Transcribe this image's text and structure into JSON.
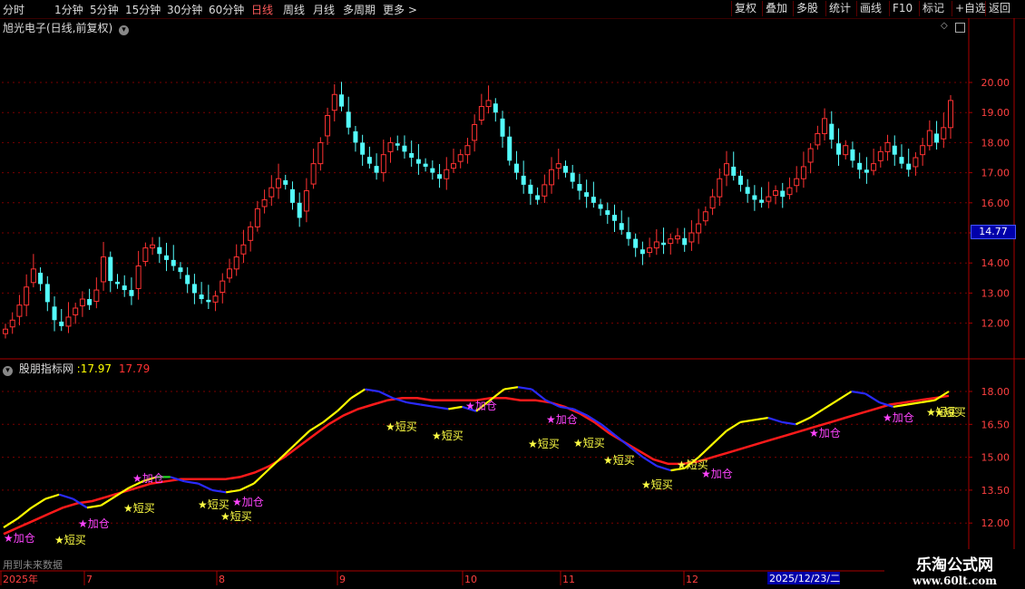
{
  "toolbar": {
    "periods": [
      "分时",
      "1分钟",
      "5分钟",
      "15分钟",
      "30分钟",
      "60分钟",
      "日线",
      "周线",
      "月线",
      "多周期",
      "更多 >"
    ],
    "active_period": "日线",
    "right_buttons": [
      "复权",
      "叠加",
      "多股",
      "统计",
      "画线",
      "F10",
      "标记",
      "+自选",
      "返回"
    ]
  },
  "main_panel": {
    "title": "旭光电子(日线,前复权)",
    "y_ticks": [
      "20.00",
      "19.00",
      "18.00",
      "17.00",
      "16.00",
      "15.00",
      "14.00",
      "13.00",
      "12.00"
    ],
    "price_badge": "14.77"
  },
  "indicator_panel": {
    "name": "股朋指标网",
    "value1": ":17.97",
    "value2": "17.79",
    "y_ticks": [
      "18.00",
      "16.50",
      "15.00",
      "13.50",
      "12.00"
    ]
  },
  "x_axis": {
    "labels": [
      "2025年",
      "7",
      "8",
      "9",
      "10",
      "11",
      "12"
    ],
    "highlight": "2025/12/23/二"
  },
  "signals": [
    {
      "text": "★加仓",
      "type": "add"
    },
    {
      "text": "★短买",
      "type": "buy"
    },
    {
      "text": "★加仓",
      "type": "add"
    },
    {
      "text": "★短买",
      "type": "buy"
    },
    {
      "text": "★加仓",
      "type": "add"
    },
    {
      "text": "★短买",
      "type": "buy"
    },
    {
      "text": "★短买",
      "type": "buy"
    },
    {
      "text": "★加仓",
      "type": "add"
    },
    {
      "text": "★短买",
      "type": "buy"
    },
    {
      "text": "★短买",
      "type": "buy"
    },
    {
      "text": "★加仓",
      "type": "add"
    },
    {
      "text": "★短买",
      "type": "buy"
    },
    {
      "text": "★加仓",
      "type": "add"
    },
    {
      "text": "★短买",
      "type": "buy"
    },
    {
      "text": "★短买",
      "type": "buy"
    },
    {
      "text": "★短买",
      "type": "buy"
    },
    {
      "text": "★短买",
      "type": "buy"
    },
    {
      "text": "★加仓",
      "type": "add"
    },
    {
      "text": "★加仓",
      "type": "add"
    },
    {
      "text": "★加仓",
      "type": "add"
    },
    {
      "text": "★短买",
      "type": "buy"
    },
    {
      "text": "★短买",
      "type": "buy"
    }
  ],
  "status_text": "用到未来数据",
  "watermark": {
    "line1": "乐淘公式网",
    "line2": "www.60lt.com"
  },
  "colors": {
    "up": "#ff3232",
    "down": "#54ffff",
    "line_yellow": "#ffff00",
    "line_blue": "#2a2aff",
    "line_green": "#22dd22",
    "line_red": "#ff1a1a",
    "add": "#ff44ff",
    "buy": "#ffff44"
  },
  "chart_data": [
    {
      "type": "candlestick",
      "title": "旭光电子(日线,前复权)",
      "ylim": [
        11.3,
        21.5
      ],
      "closes": [
        11.8,
        12.1,
        12.6,
        13.2,
        13.8,
        13.3,
        12.7,
        12.1,
        11.9,
        12.2,
        12.5,
        12.8,
        12.6,
        13.1,
        14.2,
        13.4,
        13.3,
        13.1,
        12.9,
        13.9,
        14.5,
        14.6,
        14.3,
        14.1,
        13.9,
        13.7,
        13.3,
        13.0,
        12.8,
        12.7,
        12.9,
        13.4,
        13.8,
        14.2,
        14.6,
        15.2,
        15.8,
        16.1,
        16.5,
        16.8,
        16.6,
        16.0,
        15.5,
        16.4,
        17.3,
        18.0,
        18.9,
        19.6,
        19.2,
        18.5,
        18.0,
        17.6,
        17.3,
        17.0,
        17.6,
        18.0,
        17.9,
        17.7,
        17.5,
        17.3,
        17.2,
        17.0,
        16.8,
        17.1,
        17.3,
        17.6,
        17.9,
        18.6,
        19.2,
        19.4,
        19.0,
        18.2,
        17.4,
        17.0,
        16.6,
        16.3,
        16.1,
        16.6,
        17.1,
        17.3,
        17.0,
        16.7,
        16.4,
        16.2,
        16.0,
        15.8,
        15.6,
        15.4,
        15.1,
        14.8,
        14.5,
        14.3,
        14.5,
        14.7,
        14.6,
        14.8,
        14.9,
        14.6,
        15.0,
        15.3,
        15.7,
        16.2,
        16.8,
        17.3,
        16.9,
        16.6,
        16.3,
        16.1,
        16.0,
        16.2,
        16.4,
        16.2,
        16.5,
        16.8,
        17.2,
        17.8,
        18.3,
        18.8,
        18.1,
        17.6,
        17.9,
        17.4,
        17.1,
        17.0,
        17.3,
        17.7,
        18.0,
        17.6,
        17.3,
        17.1,
        17.5,
        17.9,
        18.4,
        18.0,
        18.5,
        19.4
      ],
      "x_labels": [
        "2025年",
        "7",
        "8",
        "9",
        "10",
        "11",
        "12"
      ]
    },
    {
      "type": "line",
      "title": "股朋指标网",
      "ylim": [
        11.4,
        18.8
      ],
      "series": [
        {
          "name": "17.97",
          "values": [
            11.8,
            12.2,
            12.7,
            13.1,
            13.3,
            13.1,
            12.7,
            12.8,
            13.2,
            13.6,
            13.9,
            14.1,
            14.1,
            13.9,
            13.8,
            13.5,
            13.4,
            13.5,
            13.8,
            14.4,
            15.0,
            15.6,
            16.2,
            16.6,
            17.1,
            17.7,
            18.1,
            18.0,
            17.7,
            17.5,
            17.4,
            17.3,
            17.2,
            17.3,
            17.1,
            17.6,
            18.1,
            18.2,
            18.1,
            17.6,
            17.3,
            17.2,
            16.9,
            16.5,
            16.0,
            15.5,
            15.0,
            14.6,
            14.4,
            14.5,
            15.0,
            15.6,
            16.2,
            16.6,
            16.7,
            16.8,
            16.6,
            16.5,
            16.8,
            17.2,
            17.6,
            18.0,
            17.9,
            17.5,
            17.3,
            17.4,
            17.5,
            17.6,
            18.0
          ]
        },
        {
          "name": "17.79",
          "values": [
            11.5,
            11.8,
            12.1,
            12.4,
            12.7,
            12.9,
            13.0,
            13.2,
            13.4,
            13.6,
            13.8,
            13.9,
            14.0,
            14.0,
            14.0,
            14.0,
            14.1,
            14.3,
            14.6,
            15.0,
            15.5,
            16.0,
            16.5,
            16.9,
            17.2,
            17.4,
            17.6,
            17.7,
            17.7,
            17.6,
            17.6,
            17.6,
            17.6,
            17.7,
            17.7,
            17.6,
            17.6,
            17.5,
            17.3,
            17.0,
            16.6,
            16.1,
            15.7,
            15.3,
            14.9,
            14.7,
            14.7,
            14.8,
            15.0,
            15.2,
            15.4,
            15.6,
            15.8,
            16.0,
            16.2,
            16.4,
            16.6,
            16.8,
            17.0,
            17.2,
            17.4,
            17.5,
            17.6,
            17.7,
            17.8
          ]
        }
      ]
    }
  ]
}
